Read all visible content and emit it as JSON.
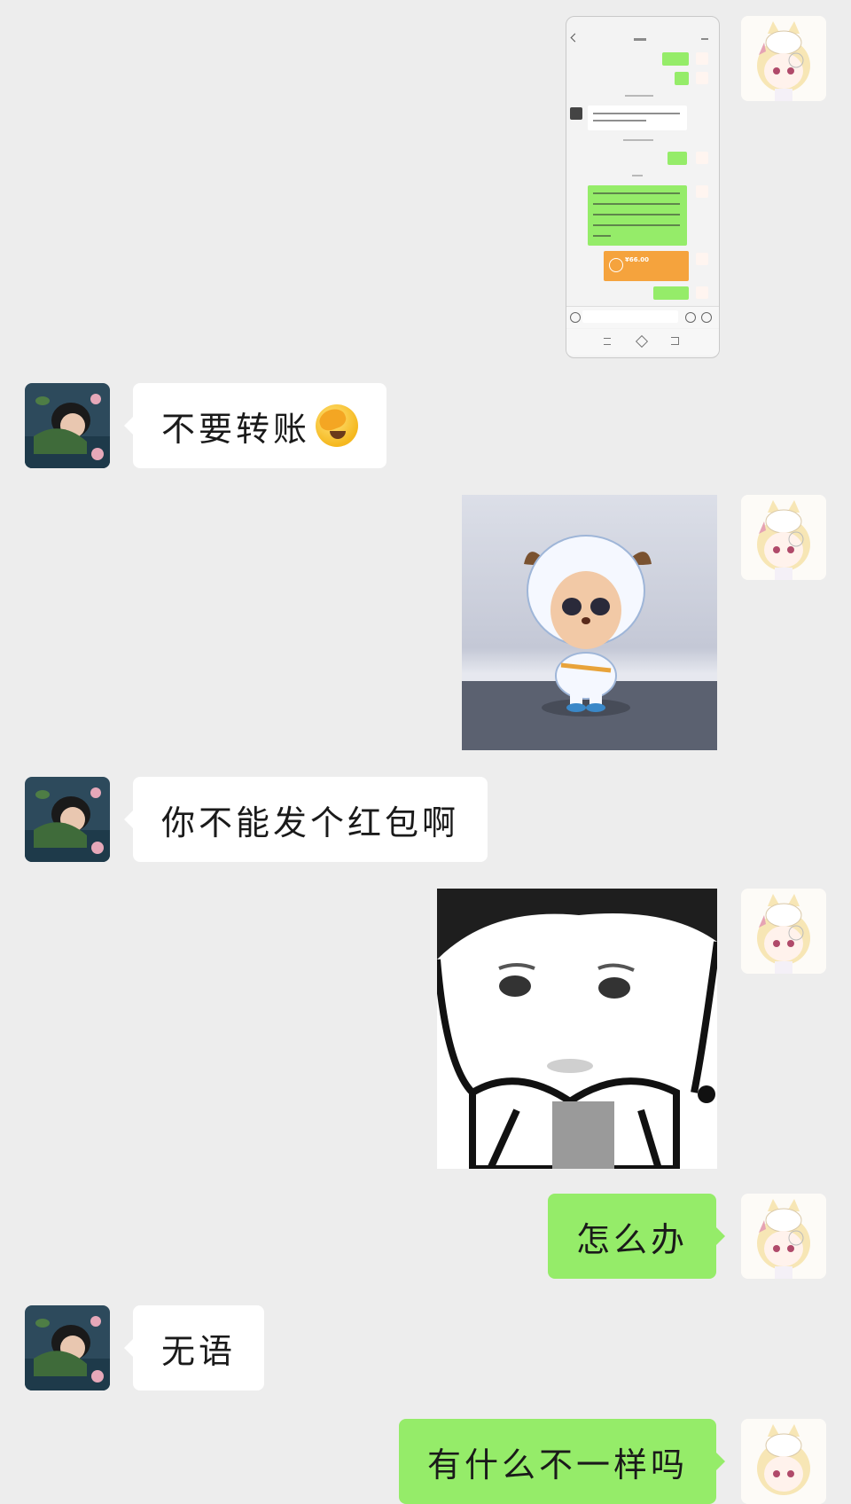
{
  "messages": [
    {
      "id": "m1",
      "sender": "me",
      "type": "image",
      "image": "chat-screenshot"
    },
    {
      "id": "m2",
      "sender": "them",
      "type": "text",
      "text": "不要转账",
      "emoji": "face-palm-emoji"
    },
    {
      "id": "m3",
      "sender": "me",
      "type": "image",
      "image": "sheep-sticker"
    },
    {
      "id": "m4",
      "sender": "them",
      "type": "text",
      "text": "你不能发个红包啊"
    },
    {
      "id": "m5",
      "sender": "me",
      "type": "image",
      "image": "face-sticker"
    },
    {
      "id": "m6",
      "sender": "me",
      "type": "text",
      "text": "怎么办"
    },
    {
      "id": "m7",
      "sender": "them",
      "type": "text",
      "text": "无语"
    },
    {
      "id": "m8",
      "sender": "me",
      "type": "text",
      "text": "有什么不一样吗"
    }
  ],
  "screenshot": {
    "transfer_amount": "¥66.00"
  },
  "colors": {
    "background": "#ededed",
    "bubble_me": "#95ec69",
    "bubble_them": "#ffffff",
    "transfer_orange": "#f5a33d"
  },
  "icons": {
    "my_avatar": "anime-girl-avatar",
    "their_avatar": "sleeping-girl-avatar",
    "emoji": "face-palm-emoji"
  }
}
